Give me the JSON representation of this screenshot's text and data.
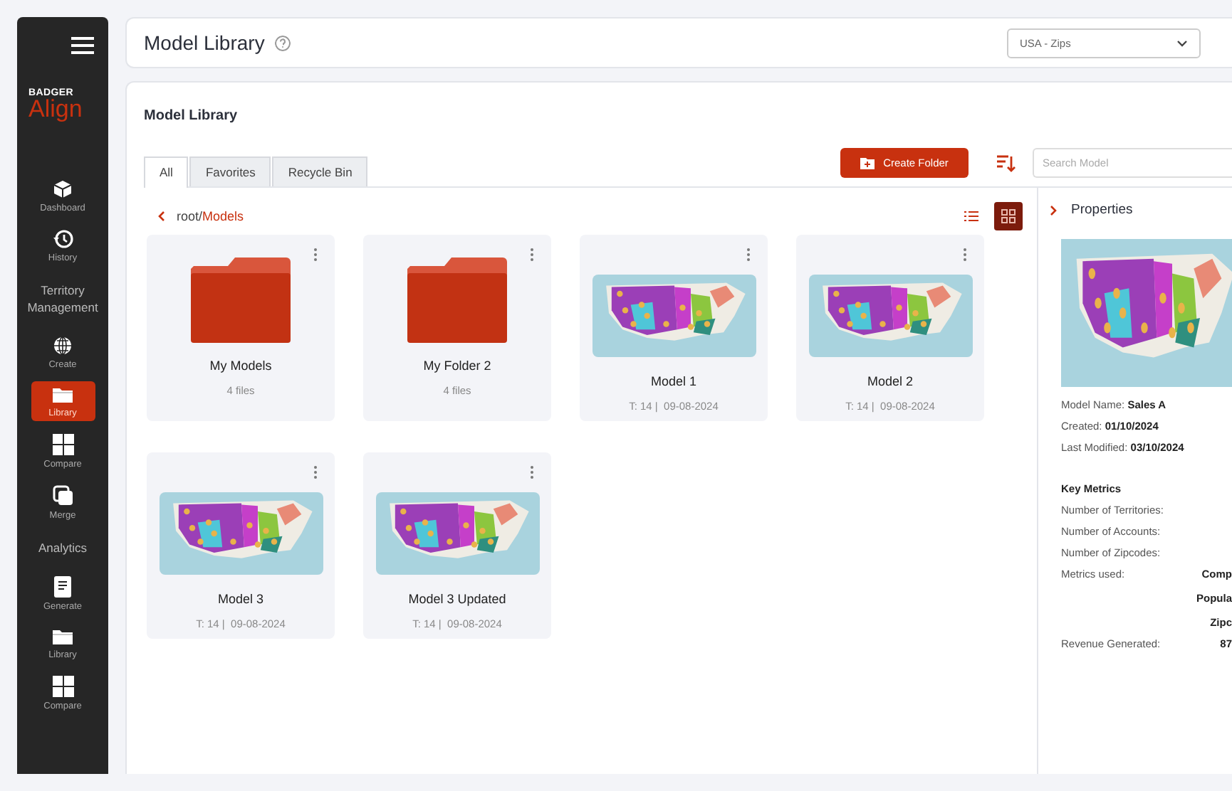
{
  "sidebar": {
    "logo_top": "BADGER",
    "logo": "Align",
    "items": [
      {
        "kind": "item",
        "label": "Dashboard",
        "selected": false
      },
      {
        "kind": "item",
        "label": "History",
        "selected": false
      },
      {
        "kind": "section",
        "label": "Territory Management"
      },
      {
        "kind": "item",
        "label": "Create",
        "selected": false
      },
      {
        "kind": "item",
        "label": "Library",
        "selected": true
      },
      {
        "kind": "item",
        "label": "Compare",
        "selected": false
      },
      {
        "kind": "item",
        "label": "Merge",
        "selected": false
      },
      {
        "kind": "section",
        "label": "Analytics"
      },
      {
        "kind": "item",
        "label": "Generate",
        "selected": false
      },
      {
        "kind": "item",
        "label": "Library",
        "selected": false
      },
      {
        "kind": "item",
        "label": "Compare",
        "selected": false
      }
    ]
  },
  "header": {
    "title": "Model Library",
    "dropdown": "USA - Zips"
  },
  "library": {
    "title": "Model Library",
    "tabs": [
      {
        "label": "All",
        "selected": true
      },
      {
        "label": "Favorites",
        "selected": false
      },
      {
        "label": "Recycle Bin",
        "selected": false
      }
    ],
    "create_button": "Create Folder",
    "search": {
      "placeholder": "Search Model"
    },
    "breadcrumb": {
      "root": "root/",
      "current": "Models"
    },
    "view": {
      "list_selected": false,
      "grid_selected": true
    },
    "cards": [
      {
        "kind": "folder",
        "name": "My Models",
        "meta": "4 files"
      },
      {
        "kind": "folder",
        "name": "My Folder 2",
        "meta": "4 files"
      },
      {
        "kind": "model",
        "name": "Model 1",
        "meta": "T: 14 |  09-08-2024"
      },
      {
        "kind": "model",
        "name": "Model 2",
        "meta": "T: 14 |  09-08-2024"
      },
      {
        "kind": "model",
        "name": "Model 3",
        "meta": "T: 14 |  09-08-2024"
      },
      {
        "kind": "model",
        "name": "Model 3 Updated",
        "meta": "T: 14 |  09-08-2024"
      }
    ]
  },
  "properties": {
    "title": "Properties",
    "details": [
      "Model Name: **Sales A**",
      "Created: **01/10/2024**",
      "Last Modified: **03/10/2024**"
    ],
    "metrics_title": "Key Metrics",
    "metrics": [
      {
        "label": "Number of Territories:"
      },
      {
        "label": "Number of Accounts:"
      },
      {
        "label": "Number of Zipcodes:"
      },
      {
        "label": "Metrics used:",
        "values": [
          "Comp",
          "Popula",
          "Zipc"
        ]
      },
      {
        "label": "Revenue Generated:",
        "values": [
          "87"
        ]
      }
    ]
  }
}
